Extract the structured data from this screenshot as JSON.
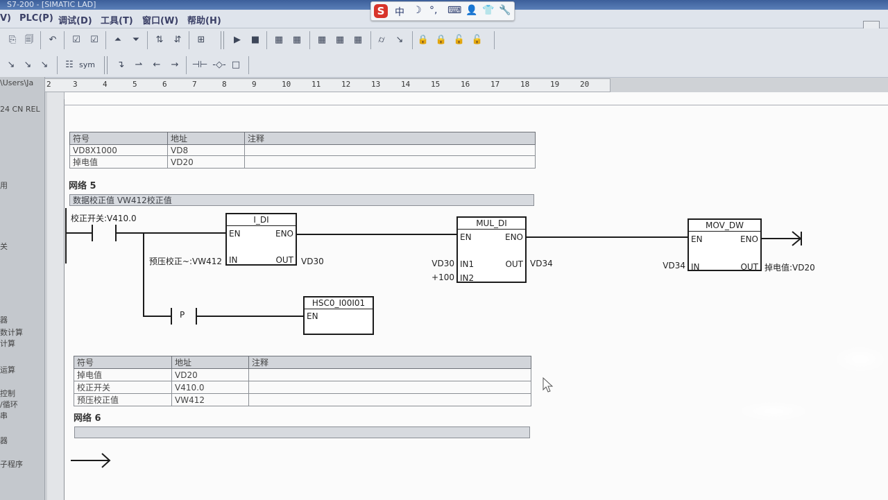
{
  "titlebar": {
    "text": "S7-200 - [SIMATIC LAD]"
  },
  "menu": [
    {
      "id": "view",
      "label": "V)"
    },
    {
      "id": "plc",
      "label": "PLC(P)"
    },
    {
      "id": "debug",
      "label": "调试(D)"
    },
    {
      "id": "tools",
      "label": "工具(T)"
    },
    {
      "id": "window",
      "label": "窗口(W)"
    },
    {
      "id": "help",
      "label": "帮助(H)"
    }
  ],
  "ime": {
    "logo": "S",
    "glyphs": [
      "中",
      "☽",
      "°,",
      "⌨",
      "👤",
      "👕",
      "🔧"
    ]
  },
  "toolbar1": [
    "⎘",
    "🗐",
    "↶",
    "☑",
    "☑",
    "⏶",
    "⏷",
    "⇅",
    "⇵",
    "⊞",
    "▶",
    "■",
    "▦",
    "▦",
    "▦",
    "▦",
    "▦",
    "⌭",
    "↘",
    "🔒",
    "🔒",
    "🔓",
    "🔓"
  ],
  "toolbar2": [
    "↘",
    "↘",
    "↘",
    "☷",
    "sym",
    "↴",
    "⇀",
    "←",
    "→",
    "⊣⊢",
    "-◇-",
    "□"
  ],
  "leftpane": [
    "\\Users\\Ja",
    "24 CN REL",
    "用",
    "关",
    "器",
    "数计算",
    "计算",
    "运算",
    "控制",
    "/循环",
    "串",
    "器",
    "子程序"
  ],
  "ruler": {
    "start": "2",
    "ticks": [
      "3",
      "4",
      "5",
      "6",
      "7",
      "8",
      "9",
      "10",
      "11",
      "12",
      "13",
      "14",
      "15",
      "16",
      "17",
      "18",
      "19",
      "20"
    ]
  },
  "symtable1": {
    "headers": [
      "符号",
      "地址",
      "注释"
    ],
    "rows": [
      [
        "VD8X1000",
        "VD8",
        ""
      ],
      [
        "掉电值",
        "VD20",
        ""
      ]
    ]
  },
  "network5": {
    "title": "网络 5",
    "comment": "数据校正值   VW412校正值",
    "contact_label": "校正开关:V410.0",
    "i_di": {
      "name": "I_DI",
      "en": "EN",
      "eno": "ENO",
      "in_pin": "IN",
      "out_pin": "OUT",
      "in_operand": "预压校正~:VW412",
      "out_operand": "VD30"
    },
    "mul_di": {
      "name": "MUL_DI",
      "en": "EN",
      "eno": "ENO",
      "in1_pin": "IN1",
      "in2_pin": "IN2",
      "out_pin": "OUT",
      "in1_operand": "VD30",
      "in2_operand": "+100",
      "out_operand": "VD34"
    },
    "mov_dw": {
      "name": "MOV_DW",
      "en": "EN",
      "eno": "ENO",
      "in_pin": "IN",
      "out_pin": "OUT",
      "in_operand": "VD34",
      "out_operand": "掉电值:VD20"
    },
    "p_contact": "P",
    "hsc": {
      "name": "HSC0_I00I01",
      "en": "EN"
    }
  },
  "symtable2": {
    "headers": [
      "符号",
      "地址",
      "注释"
    ],
    "rows": [
      [
        "掉电值",
        "VD20",
        ""
      ],
      [
        "校正开关",
        "V410.0",
        ""
      ],
      [
        "预压校正值",
        "VW412",
        ""
      ]
    ]
  },
  "network6": {
    "title": "网络 6",
    "comment": ""
  }
}
